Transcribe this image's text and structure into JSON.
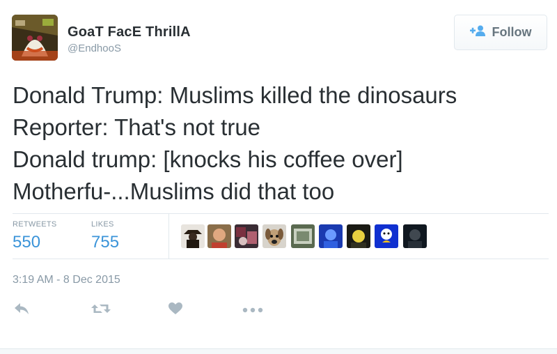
{
  "author": {
    "display_name": "GoaT FacE ThrillA",
    "handle": "@EndhooS",
    "avatar_icon": "goat-face-avatar"
  },
  "follow_button": {
    "label": "Follow",
    "icon": "follow-person-plus-icon"
  },
  "tweet": {
    "lines": [
      "Donald Trump: Muslims killed the dinosaurs",
      "Reporter: That's not true",
      "Donald trump: [knocks his coffee over]",
      "Motherfu-...Muslims did that too"
    ]
  },
  "stats": {
    "retweets_label": "RETWEETS",
    "retweets_value": "550",
    "likes_label": "LIKES",
    "likes_value": "755"
  },
  "liker_avatars": [
    "liker-avatar-1",
    "liker-avatar-2",
    "liker-avatar-3",
    "liker-avatar-4",
    "liker-avatar-5",
    "liker-avatar-6",
    "liker-avatar-7",
    "liker-avatar-8",
    "liker-avatar-9"
  ],
  "timestamp": "3:19 AM - 8 Dec 2015",
  "actions": [
    "reply-icon",
    "retweet-icon",
    "like-heart-icon",
    "more-icon"
  ],
  "colors": {
    "text": "#292f33",
    "muted": "#8899a6",
    "stat_value": "#3b94d9",
    "follow_icon": "#55acee",
    "action_icon": "#aab8c2",
    "divider": "#e1e8ed"
  }
}
